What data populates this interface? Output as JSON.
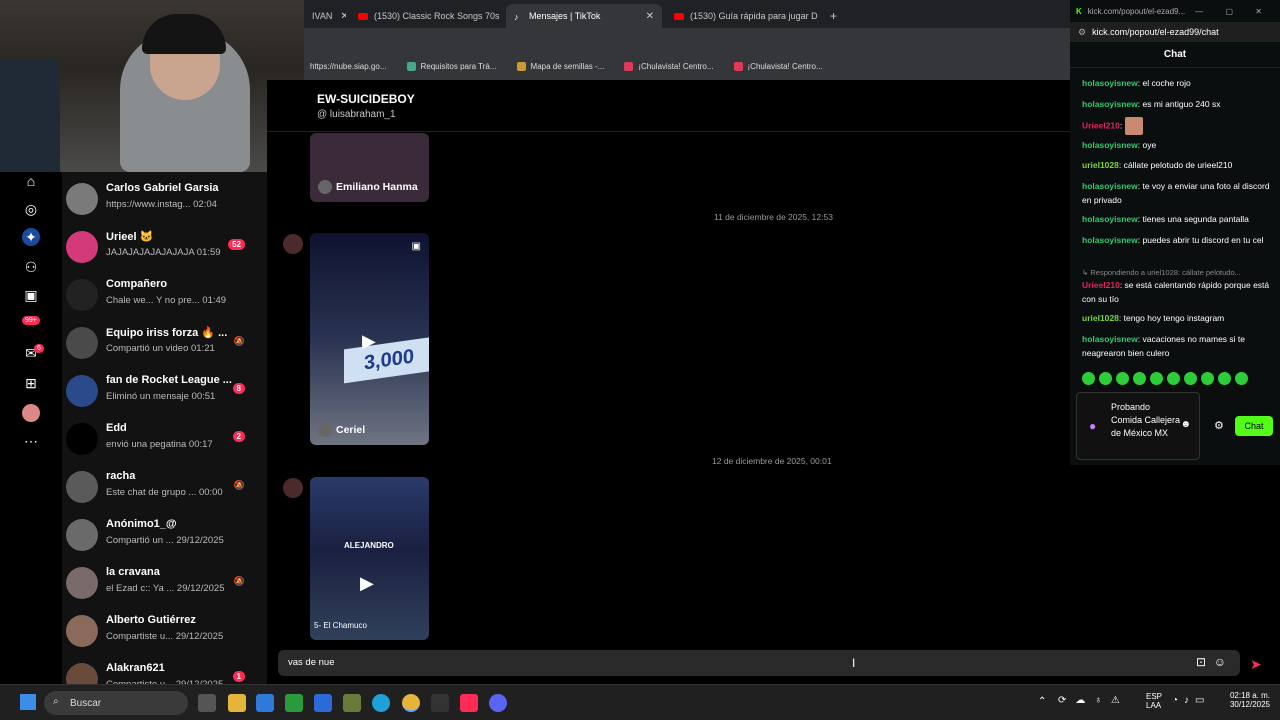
{
  "browser": {
    "tabs": [
      {
        "label": "IVAN",
        "active": false
      },
      {
        "label": "(1530) Classic Rock Songs 70s 8",
        "active": false
      },
      {
        "label": "Mensajes | TikTok",
        "active": true
      },
      {
        "label": "(1530) Guía rápida para jugar D",
        "active": false
      }
    ],
    "new_tab": "+",
    "bookmarks": [
      "https://nube.siap.go...",
      "Requisitos para Trá...",
      "Mapa de semillas -...",
      "¡Chulavista! Centro...",
      "¡Chulavista! Centro..."
    ]
  },
  "nav": {
    "badge_99": "99+",
    "badge_inbox": "6"
  },
  "conversations": [
    {
      "name": "Carlos Gabriel Garsia",
      "preview": "https://www.instag... 02:04",
      "badge": "",
      "muted": false
    },
    {
      "name": "Urieel 🐱",
      "preview": "JAJAJAJAJAJAJAJA 01:59",
      "badge": "52",
      "muted": false
    },
    {
      "name": "Compañero",
      "preview": "Chale we... Y no pre... 01:49",
      "badge": "",
      "muted": false
    },
    {
      "name": "Equipo iriss forza 🔥 ...",
      "preview": "Compartió un video 01:21",
      "badge": "",
      "muted": true
    },
    {
      "name": "fan de Rocket League ...",
      "preview": "Eliminó un mensaje 00:51",
      "badge": "8",
      "muted": false
    },
    {
      "name": "Edd",
      "preview": "envió una pegatina 00:17",
      "badge": "2",
      "muted": false
    },
    {
      "name": "racha",
      "preview": "Este chat de grupo ... 00:00",
      "badge": "",
      "muted": true
    },
    {
      "name": "Anónimo1_@",
      "preview": "Compartió un ... 29/12/2025",
      "badge": "",
      "muted": false
    },
    {
      "name": "la cravana",
      "preview": "el Ezad c:: Ya ... 29/12/2025",
      "badge": "",
      "muted": true
    },
    {
      "name": "Alberto Gutiérrez",
      "preview": "Compartiste u... 29/12/2025",
      "badge": "",
      "muted": false
    },
    {
      "name": "Alakran621",
      "preview": "Compartiste u... 29/12/2025",
      "badge": "1",
      "muted": false
    }
  ],
  "chat": {
    "header_name": "EW-SUICIDEBOY",
    "header_handle": "@ luisabraham_1",
    "cards": [
      {
        "label": "Emiliano Hanma"
      },
      {
        "label": "Ceriel",
        "overlay": "3,000"
      },
      {
        "overlay_name": "ALEJANDRO",
        "footer": "5- El Chamuco"
      }
    ],
    "date1": "11 de diciembre de 2025, 12:53",
    "date2": "12 de diciembre de 2025, 00:01",
    "input_value": "vas de nue"
  },
  "kick": {
    "window_title": "kick.com/popout/el-ezad9...",
    "url": "kick.com/popout/el-ezad99/chat",
    "header": "Chat",
    "messages": [
      {
        "user": "holasoyisnew",
        "text": "el coche rojo",
        "color": "#2ecc71"
      },
      {
        "user": "holasoyisnew",
        "text": "es mi antiguo 240 sx",
        "color": "#2ecc71"
      },
      {
        "user": "Urieel210",
        "text": "",
        "color": "#e0245e"
      },
      {
        "user": "holasoyisnew",
        "text": "oye",
        "color": "#2ecc71"
      },
      {
        "user": "uriel1028",
        "text": "cállate pelotudo de urieel210",
        "color": "#7cd33a"
      },
      {
        "user": "holasoyisnew",
        "text": "te voy a enviar una foto al discord en privado",
        "color": "#2ecc71"
      },
      {
        "user": "holasoyisnew",
        "text": "tienes una segunda pantalla",
        "color": "#2ecc71"
      },
      {
        "user": "holasoyisnew",
        "text": "puedes abrir tu discord en tu cel",
        "color": "#2ecc71"
      },
      {
        "user": "",
        "text": "↳ Respondiendo a uriel1028: cállate pelotudo...",
        "color": "#888"
      },
      {
        "user": "Urieel210",
        "text": "se está calentando rápido porque está con su tío",
        "color": "#e0245e"
      },
      {
        "user": "uriel1028",
        "text": "tengo hoy tengo instagram",
        "color": "#7cd33a"
      },
      {
        "user": "holasoyisnew",
        "text": "vacaciones no mames si te neagrearon bien culero",
        "color": "#2ecc71"
      }
    ],
    "stream_title": "Probando Comida Callejera de México MX",
    "chat_button": "Chat"
  },
  "taskbar": {
    "search": "Buscar",
    "lang": "ESP",
    "lang2": "LAA",
    "time": "02:18 a. m.",
    "date": "30/12/2025"
  }
}
